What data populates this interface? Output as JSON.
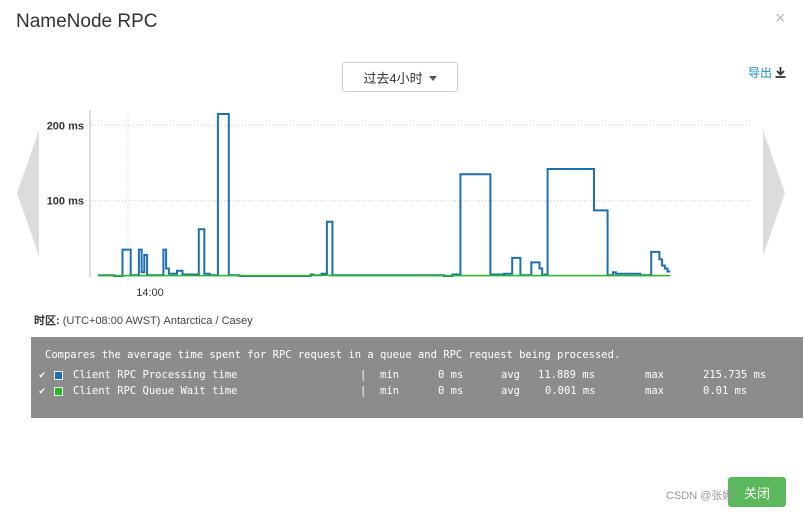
{
  "dialog": {
    "title": "NameNode RPC",
    "close_symbol": "×",
    "time_range_label": "过去4小时",
    "export_label": "导出",
    "timezone_label": "时区:",
    "timezone_value": "(UTC+08:00 AWST) Antarctica / Casey",
    "footer_button_label": "关闭",
    "watermark": "CSDN @张娜"
  },
  "legend": {
    "description": "Compares the average time spent for RPC request in a queue and RPC request being processed.",
    "rows": [
      {
        "check": "✔",
        "name": "Client RPC Processing time",
        "sep": "|",
        "min_label": "min",
        "min": "0 ms",
        "avg_label": "avg",
        "avg": "11.889 ms",
        "max_label": "max",
        "max": "215.735 ms"
      },
      {
        "check": "✔",
        "name": "Client RPC Queue Wait time",
        "sep": "|",
        "min_label": "min",
        "min": "0 ms",
        "avg_label": "avg",
        "avg": "0.001 ms",
        "max_label": "max",
        "max": "0.01 ms"
      }
    ]
  },
  "colors": {
    "processing": "#1f6fb0",
    "queue": "#22bb22",
    "legend_bg": "#8c8c8c",
    "accent": "#1a8bbf",
    "button": "#5cb85c"
  },
  "chart_data": {
    "type": "line",
    "x_unit": "minutes",
    "xlim": [
      0,
      240
    ],
    "ylim": [
      0,
      215
    ],
    "y_ticks": [
      {
        "value": 100,
        "label": "100 ms"
      },
      {
        "value": 200,
        "label": "200 ms"
      }
    ],
    "x_ticks": [
      {
        "value": 11,
        "label": "14:00"
      }
    ],
    "grid": true,
    "legend": "below",
    "series": [
      {
        "name": "Client RPC Processing time",
        "color": "#1f6fb0",
        "points": [
          [
            0,
            1
          ],
          [
            6,
            1
          ],
          [
            6,
            0
          ],
          [
            9,
            0
          ],
          [
            9,
            35
          ],
          [
            12,
            35
          ],
          [
            12,
            1
          ],
          [
            15,
            1
          ],
          [
            15,
            35
          ],
          [
            16,
            35
          ],
          [
            16,
            5
          ],
          [
            17,
            5
          ],
          [
            17,
            28
          ],
          [
            18,
            28
          ],
          [
            18,
            1
          ],
          [
            22,
            1
          ],
          [
            22,
            1
          ],
          [
            24,
            1
          ],
          [
            24,
            35
          ],
          [
            25,
            35
          ],
          [
            25,
            10
          ],
          [
            26,
            10
          ],
          [
            26,
            3
          ],
          [
            29,
            3
          ],
          [
            29,
            7
          ],
          [
            31,
            7
          ],
          [
            31,
            2
          ],
          [
            37,
            2
          ],
          [
            37,
            62
          ],
          [
            39,
            62
          ],
          [
            39,
            3
          ],
          [
            41,
            3
          ],
          [
            41,
            1
          ],
          [
            44,
            1
          ],
          [
            44,
            215
          ],
          [
            48,
            215
          ],
          [
            48,
            1
          ],
          [
            52,
            1
          ],
          [
            52,
            0
          ],
          [
            78,
            0
          ],
          [
            78,
            2
          ],
          [
            79,
            2
          ],
          [
            79,
            1
          ],
          [
            82,
            1
          ],
          [
            82,
            3
          ],
          [
            83,
            3
          ],
          [
            83,
            3
          ],
          [
            84,
            3
          ],
          [
            84,
            72
          ],
          [
            86,
            72
          ],
          [
            86,
            1
          ],
          [
            127,
            1
          ],
          [
            127,
            0
          ],
          [
            130,
            0
          ],
          [
            130,
            2
          ],
          [
            133,
            2
          ],
          [
            133,
            135
          ],
          [
            144,
            135
          ],
          [
            144,
            2
          ],
          [
            149,
            2
          ],
          [
            149,
            3
          ],
          [
            152,
            3
          ],
          [
            152,
            24
          ],
          [
            155,
            24
          ],
          [
            155,
            1
          ],
          [
            159,
            1
          ],
          [
            159,
            18
          ],
          [
            162,
            18
          ],
          [
            162,
            10
          ],
          [
            163,
            10
          ],
          [
            163,
            1
          ],
          [
            164,
            1
          ],
          [
            164,
            2
          ],
          [
            165,
            2
          ],
          [
            165,
            142
          ],
          [
            182,
            142
          ],
          [
            182,
            87
          ],
          [
            187,
            87
          ],
          [
            187,
            1
          ],
          [
            189,
            1
          ],
          [
            189,
            5
          ],
          [
            190,
            5
          ],
          [
            190,
            3
          ],
          [
            199,
            3
          ],
          [
            199,
            1
          ],
          [
            203,
            1
          ],
          [
            203,
            32
          ],
          [
            206,
            32
          ],
          [
            206,
            22
          ],
          [
            207,
            22
          ],
          [
            207,
            14
          ],
          [
            208,
            14
          ],
          [
            208,
            10
          ],
          [
            209,
            10
          ],
          [
            209,
            6
          ],
          [
            210,
            6
          ]
        ]
      },
      {
        "name": "Client RPC Queue Wait time",
        "color": "#22bb22",
        "points": [
          [
            0,
            0.5
          ],
          [
            78,
            0.5
          ],
          [
            78,
            1
          ],
          [
            85,
            1
          ],
          [
            85,
            0.5
          ],
          [
            210,
            0.5
          ]
        ]
      }
    ]
  }
}
